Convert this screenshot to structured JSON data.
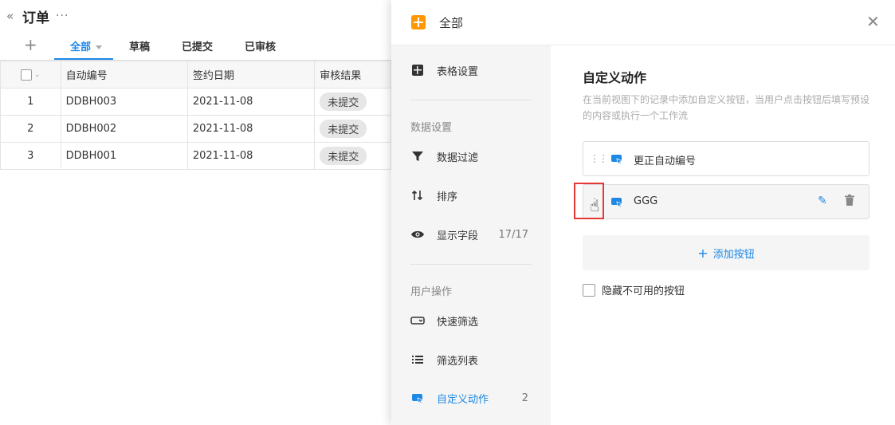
{
  "header": {
    "title": "订单",
    "back_icon": "double-chevron-left-icon",
    "more_label": "···"
  },
  "tabs": [
    {
      "label": "全部",
      "active": true
    },
    {
      "label": "草稿",
      "active": false
    },
    {
      "label": "已提交",
      "active": false
    },
    {
      "label": "已审核",
      "active": false
    }
  ],
  "tabs_add_label": "+",
  "table": {
    "columns": [
      "自动编号",
      "签约日期",
      "审核结果"
    ],
    "rows": [
      {
        "index": "1",
        "code": "DDBH003",
        "date": "2021-11-08",
        "status": "未提交"
      },
      {
        "index": "2",
        "code": "DDBH002",
        "date": "2021-11-08",
        "status": "未提交"
      },
      {
        "index": "3",
        "code": "DDBH001",
        "date": "2021-11-08",
        "status": "未提交"
      }
    ]
  },
  "drawer": {
    "title": "全部",
    "close_label": "✕",
    "nav": {
      "table_settings": "表格设置",
      "data_group": "数据设置",
      "data_filter": "数据过滤",
      "sort": "排序",
      "display_fields": "显示字段",
      "display_fields_count": "17/17",
      "user_group": "用户操作",
      "quick_filter": "快速筛选",
      "filter_list": "筛选列表",
      "custom_actions": "自定义动作",
      "custom_actions_count": "2"
    },
    "panel": {
      "title": "自定义动作",
      "description": "在当前视图下的记录中添加自定义按钮，当用户点击按钮后填写预设的内容或执行一个工作流",
      "actions": [
        {
          "label": "更正自动编号"
        },
        {
          "label": "GGG"
        }
      ],
      "add_button": "添加按钮",
      "hide_unavailable": "隐藏不可用的按钮"
    }
  },
  "colors": {
    "accent": "#1e88e5",
    "view_icon": "#ff9800",
    "highlight": "#e53935"
  }
}
